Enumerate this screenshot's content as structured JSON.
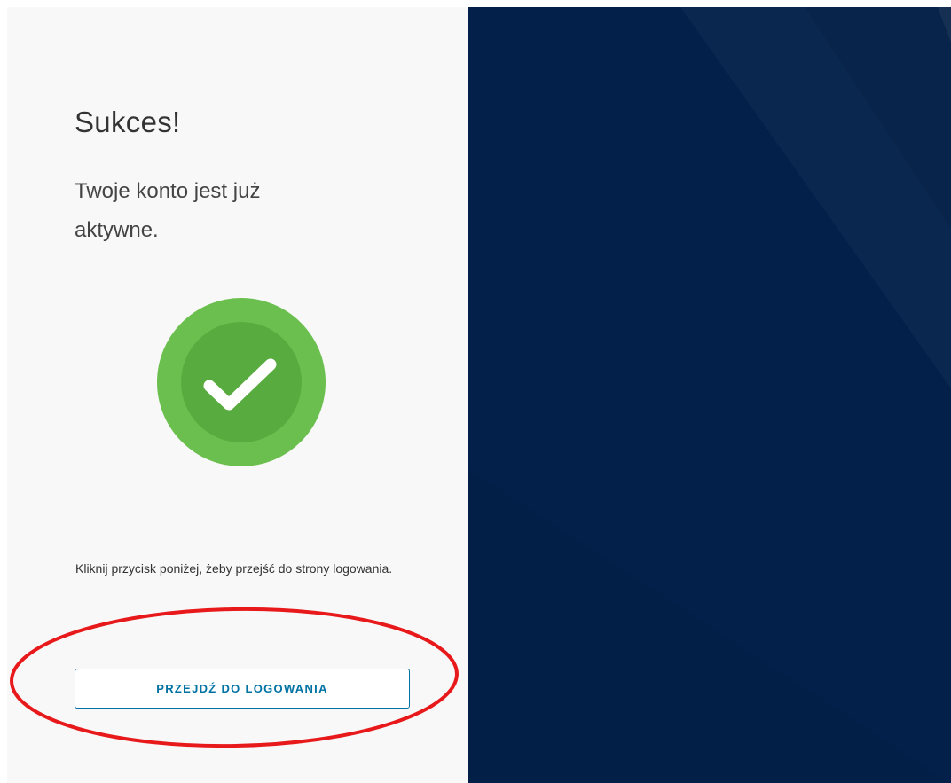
{
  "success": {
    "title": "Sukces!",
    "message": "Twoje konto jest już aktywne.",
    "icon": "checkmark-circle-icon",
    "icon_colors": {
      "outer": "#6bbf4e",
      "inner": "#58ab3e",
      "check": "#ffffff"
    }
  },
  "instruction": "Kliknij przycisk poniżej, żeby przejść do strony logowania.",
  "login_button": {
    "label": "PRZEJDŹ DO LOGOWANIA",
    "color": "#0072a3"
  },
  "annotation": {
    "shape": "ellipse",
    "color": "#e8191a"
  },
  "background": {
    "panel_color": "#03204a"
  }
}
